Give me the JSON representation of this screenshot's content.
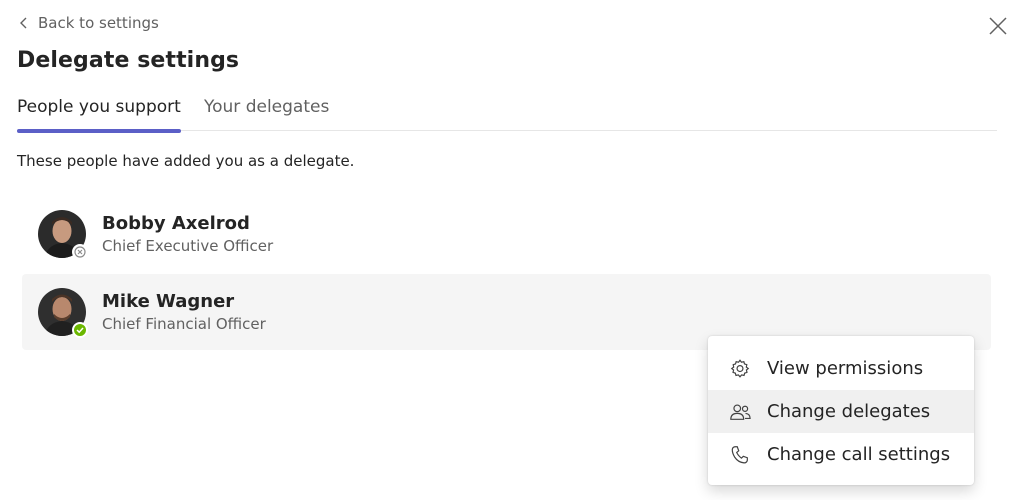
{
  "header": {
    "back_label": "Back to settings",
    "title": "Delegate settings"
  },
  "tabs": [
    {
      "label": "People you support",
      "active": true
    },
    {
      "label": "Your delegates",
      "active": false
    }
  ],
  "intro": "These people have added you as a delegate.",
  "people": [
    {
      "name": "Bobby Axelrod",
      "title": "Chief Executive Officer",
      "presence": "offline"
    },
    {
      "name": "Mike Wagner",
      "title": "Chief Financial Officer",
      "presence": "available"
    }
  ],
  "context_menu": {
    "items": [
      {
        "label": "View permissions",
        "icon": "gear-icon"
      },
      {
        "label": "Change delegates",
        "icon": "people-icon"
      },
      {
        "label": "Change call settings",
        "icon": "phone-icon"
      }
    ]
  },
  "colors": {
    "accent": "#5b5fc7",
    "available": "#6bb700",
    "hover_row": "#f5f5f5"
  }
}
